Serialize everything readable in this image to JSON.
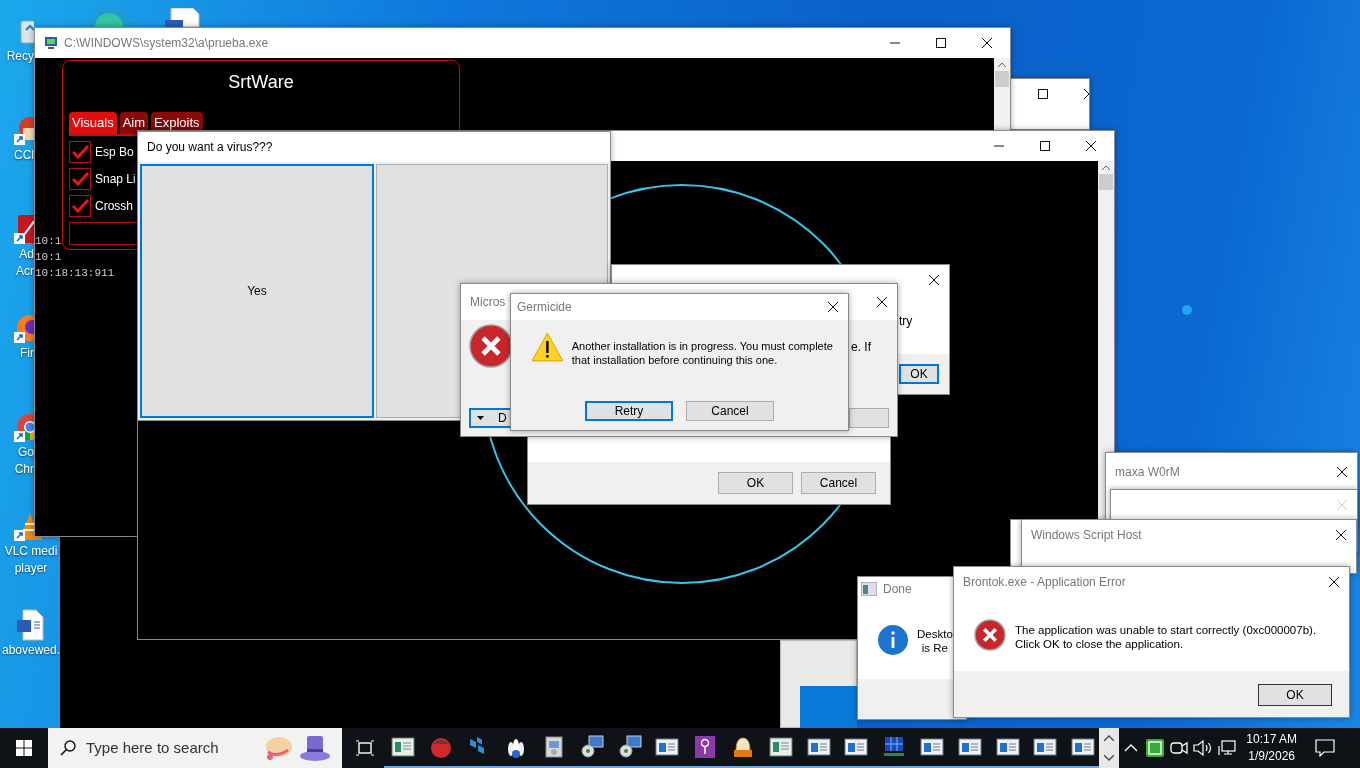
{
  "desktop": {
    "icons": [
      {
        "lines": [
          "Recy"
        ]
      },
      {
        "lines": [
          "CCl"
        ]
      },
      {
        "lines": [
          "Ad",
          "Acr"
        ]
      },
      {
        "lines": [
          "Fir"
        ]
      },
      {
        "lines": [
          "Go",
          "Chr"
        ]
      },
      {
        "lines": [
          "VLC medi",
          "player"
        ]
      },
      {
        "lines": [
          "abovewed."
        ]
      }
    ]
  },
  "console_window": {
    "title": "C:\\WINDOWS\\system32\\a\\prueba.exe",
    "lines": [
      "10:1",
      "10:1",
      "10:18:13:911"
    ],
    "menu": {
      "title": "SrtWare",
      "tabs": [
        {
          "label": "Visuals",
          "selected": true
        },
        {
          "label": "Aim",
          "selected": false
        },
        {
          "label": "Exploits",
          "selected": false
        }
      ],
      "options": [
        {
          "label": "Esp Bo",
          "checked": true
        },
        {
          "label": "Snap Li",
          "checked": true
        },
        {
          "label": "Crossh",
          "checked": true
        }
      ]
    }
  },
  "virus_window": {
    "title": "Do you want a virus???",
    "buttons": [
      {
        "label": "Yes",
        "focused": true
      },
      {
        "focused": false
      }
    ]
  },
  "back_dialog": {
    "text": "try",
    "button": {
      "label": "OK",
      "focused": true
    }
  },
  "confirm_dialog": {
    "buttons": [
      {
        "label": "OK"
      },
      {
        "label": "Cancel"
      }
    ]
  },
  "error_dialog": {
    "title": "Micros",
    "text": "e. If",
    "details_button": "D"
  },
  "germicide_dialog": {
    "title": "Germicide",
    "message": "Another installation is in progress. You must complete that installation before continuing this one.",
    "buttons": [
      {
        "label": "Retry",
        "focused": true
      },
      {
        "label": "Cancel",
        "focused": false
      }
    ]
  },
  "worm_window": {
    "title": "maxa W0rM"
  },
  "script_host_window": {
    "title": "Windows Script Host"
  },
  "done_dialog": {
    "title": "Done",
    "lines": [
      "Deskto",
      "is Re"
    ]
  },
  "app_error_dialog": {
    "title": "Brontok.exe - Application Error",
    "lines": [
      "The application was unable to start correctly (0xc000007b).",
      "Click OK to close the application."
    ],
    "button": "OK"
  },
  "taskbar": {
    "search": {
      "placeholder": "Type here to search"
    },
    "clock": {
      "time": "10:17 AM",
      "date": "1/9/2026"
    }
  }
}
